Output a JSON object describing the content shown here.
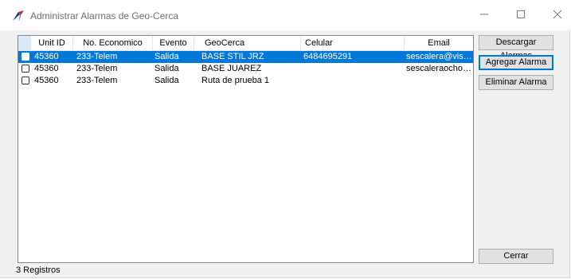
{
  "window": {
    "title": "Administrar Alarmas de Geo-Cerca",
    "controls": {
      "minimize": "—",
      "maximize": "☐",
      "close": "✕"
    }
  },
  "grid": {
    "columns": [
      "Unit ID",
      "No. Economico",
      "Evento",
      "GeoCerca",
      "Celular",
      "Email"
    ],
    "rows": [
      {
        "unit_id": "45360",
        "no_economico": "233-Telem",
        "evento": "Salida",
        "geocerca": "BASE STIL JRZ",
        "celular": "6484695291",
        "email": "sescalera@vision...",
        "selected": true
      },
      {
        "unit_id": "45360",
        "no_economico": "233-Telem",
        "evento": "Salida",
        "geocerca": "BASE JUAREZ",
        "celular": "",
        "email": "sescaleraochoa...",
        "selected": false
      },
      {
        "unit_id": "45360",
        "no_economico": "233-Telem",
        "evento": "Salida",
        "geocerca": "Ruta de prueba 1",
        "celular": "",
        "email": "",
        "selected": false
      }
    ]
  },
  "buttons": {
    "download": "Descargar Alarmas",
    "add": "Agregar Alarma",
    "delete": "Eliminar Alarma",
    "close": "Cerrar"
  },
  "status": {
    "records": "3 Registros"
  },
  "colors": {
    "selection": "#0078d7",
    "title_text": "#6d6d6d",
    "button_face": "#e1e1e1"
  }
}
